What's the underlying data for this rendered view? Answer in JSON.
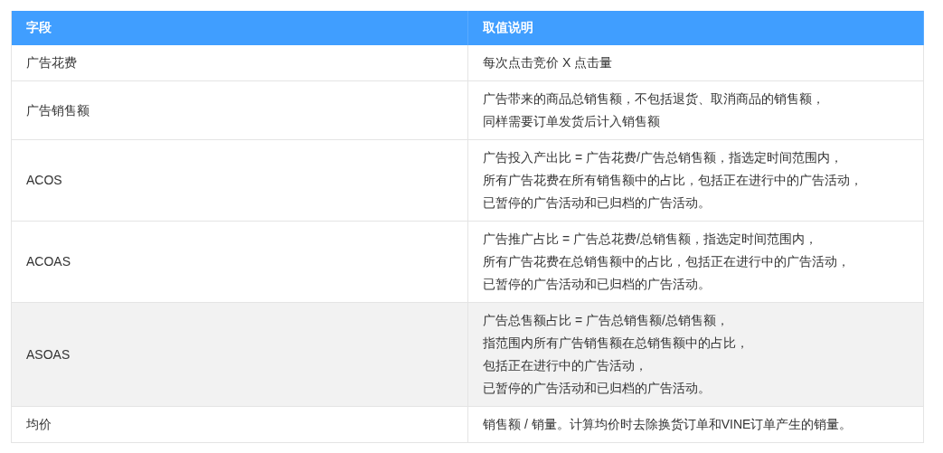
{
  "table": {
    "columns": [
      "字段",
      "取值说明"
    ],
    "rows": [
      {
        "field": "广告花费",
        "description": [
          "每次点击竞价 X 点击量"
        ],
        "highlighted": false
      },
      {
        "field": "广告销售额",
        "description": [
          "广告带来的商品总销售额，不包括退货、取消商品的销售额，",
          "同样需要订单发货后计入销售额"
        ],
        "highlighted": false
      },
      {
        "field": "ACOS",
        "description": [
          "广告投入产出比 = 广告花费/广告总销售额，指选定时间范围内，",
          "所有广告花费在所有销售额中的占比，包括正在进行中的广告活动，",
          "已暂停的广告活动和已归档的广告活动。"
        ],
        "highlighted": false
      },
      {
        "field": "ACOAS",
        "description": [
          "广告推广占比 = 广告总花费/总销售额，指选定时间范围内，",
          "所有广告花费在总销售额中的占比，包括正在进行中的广告活动，",
          "已暂停的广告活动和已归档的广告活动。"
        ],
        "highlighted": false
      },
      {
        "field": "ASOAS",
        "description": [
          "广告总售额占比 = 广告总销售额/总销售额，",
          "指范围内所有广告销售额在总销售额中的占比，",
          "包括正在进行中的广告活动，",
          "已暂停的广告活动和已归档的广告活动。"
        ],
        "highlighted": true
      },
      {
        "field": "均价",
        "description": [
          "销售额 / 销量。计算均价时去除换货订单和VINE订单产生的销量。"
        ],
        "highlighted": false
      }
    ]
  }
}
